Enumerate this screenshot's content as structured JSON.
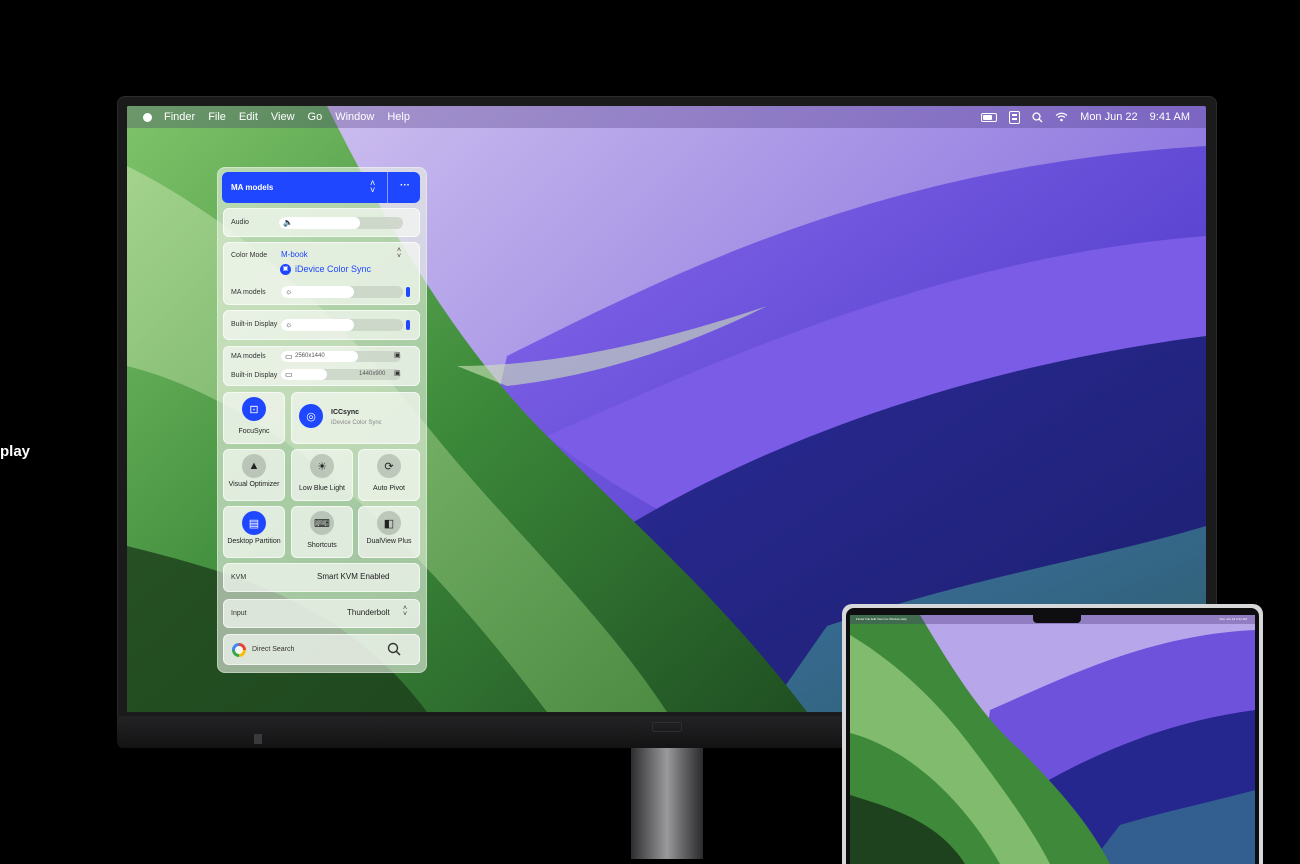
{
  "edge_text": "play",
  "menubar": {
    "apple_icon": "apple-icon",
    "items": [
      "Finder",
      "File",
      "Edit",
      "View",
      "Go",
      "Window",
      "Help"
    ],
    "date": "Mon Jun 22",
    "time": "9:41 AM"
  },
  "panel": {
    "header": {
      "title": "MA models",
      "updown_icon": "up-down-chevron-icon",
      "more_label": "···"
    },
    "audio": {
      "label": "Audio",
      "level": 0.65
    },
    "color_mode": {
      "label": "Color Mode",
      "value": "M-book",
      "sync_label": "iDevice Color Sync",
      "brightness_label": "MA models",
      "brightness_level": 0.6
    },
    "builtin_brightness": {
      "label": "Built-in Display",
      "level": 0.6
    },
    "resolution": {
      "row1_label": "MA models",
      "row1_value": "2560x1440",
      "row2_label": "Built-in Display",
      "row2_value": "1440x900"
    },
    "focusync": {
      "label": "FocuSync"
    },
    "iccsync": {
      "title": "ICCsync",
      "subtitle": "iDevice Color Sync"
    },
    "tiles_row1": [
      "Visual Optimizer",
      "Low Blue Light",
      "Auto Pivot"
    ],
    "tiles_row2": [
      "Desktop Partition",
      "Shortcuts",
      "DualView Plus"
    ],
    "kvm": {
      "label": "KVM",
      "value": "Smart KVM Enabled"
    },
    "input": {
      "label": "Input",
      "value": "Thunderbolt"
    },
    "search": {
      "label": "Direct Search"
    }
  },
  "laptop_menubar": {
    "items": "Finder  File  Edit  View  Go  Window  Help",
    "right": "Mon Jun 22  9:41 AM"
  },
  "colors": {
    "accent_blue": "#1f47ff",
    "wallpaper_green": "#3f8a3a",
    "wallpaper_purple": "#6a4ed6",
    "wallpaper_navy": "#28268a"
  }
}
